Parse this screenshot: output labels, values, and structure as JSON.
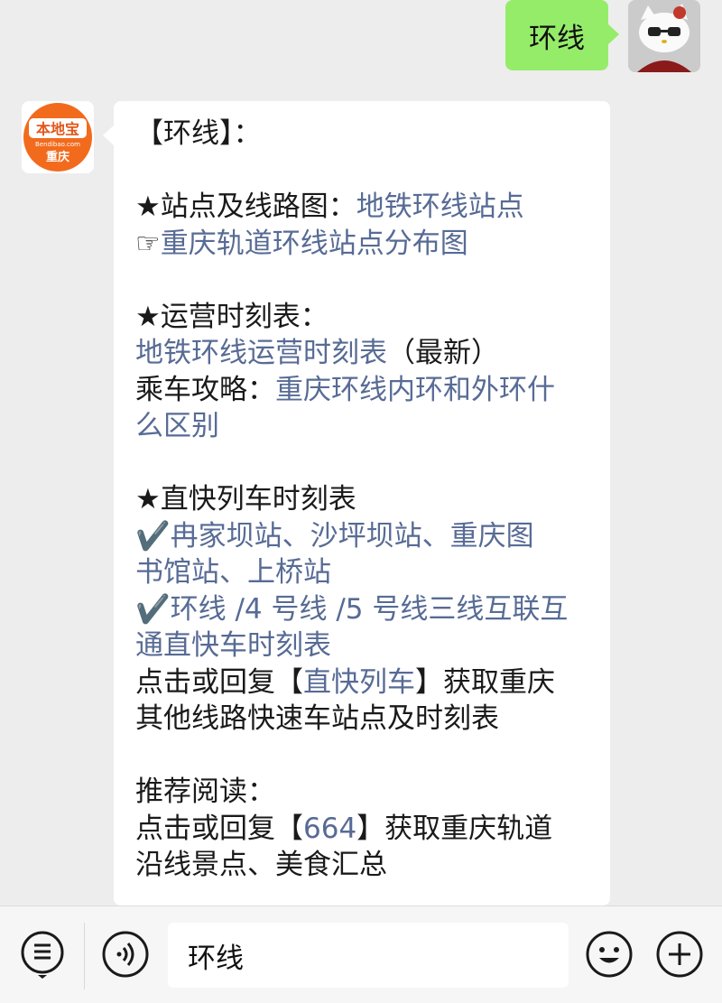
{
  "outgoing": {
    "text": "环线"
  },
  "brand_avatar": {
    "line1": "本地宝",
    "line2": "Bendibao.com",
    "line3": "重庆"
  },
  "message": {
    "title": "【环线】：",
    "s1_head": "★站点及线路图：",
    "s1_link1": "地铁环线站点",
    "s1_hand": "☞",
    "s1_link2": "重庆轨道环线站点分布图",
    "s2_head": "★运营时刻表：",
    "s2_link1": "地铁环线运营时刻表",
    "s2_suffix": "（最新）",
    "s2_label": "乘车攻略：",
    "s2_link2a": "重庆环线内环和外环什",
    "s2_link2b": "么区别",
    "s3_head": "★直快列车时刻表",
    "s3_check": "✔️",
    "s3_link1a": "冉家坝站、沙坪坝站、重庆图",
    "s3_link1b": "书馆站、上桥站",
    "s3_link2a": "环线 /4 号线 /5 号线三线互联互",
    "s3_link2b": "通直快车时刻表",
    "s3_p1": "点击或回复【",
    "s3_kw": "直快列车",
    "s3_p2": "】获取重庆",
    "s3_line2": "其他线路快速车站点及时刻表",
    "s4_head": "推荐阅读：",
    "s4_p1": "点击或回复【",
    "s4_kw": "664",
    "s4_p2": "】获取重庆轨道",
    "s4_line2": "沿线景点、美食汇总"
  },
  "input_bar": {
    "text": "环线"
  },
  "colors": {
    "link": "#576b95",
    "outgoing_bubble": "#95ec69",
    "background": "#ededed",
    "brand_orange": "#f26b1d"
  }
}
